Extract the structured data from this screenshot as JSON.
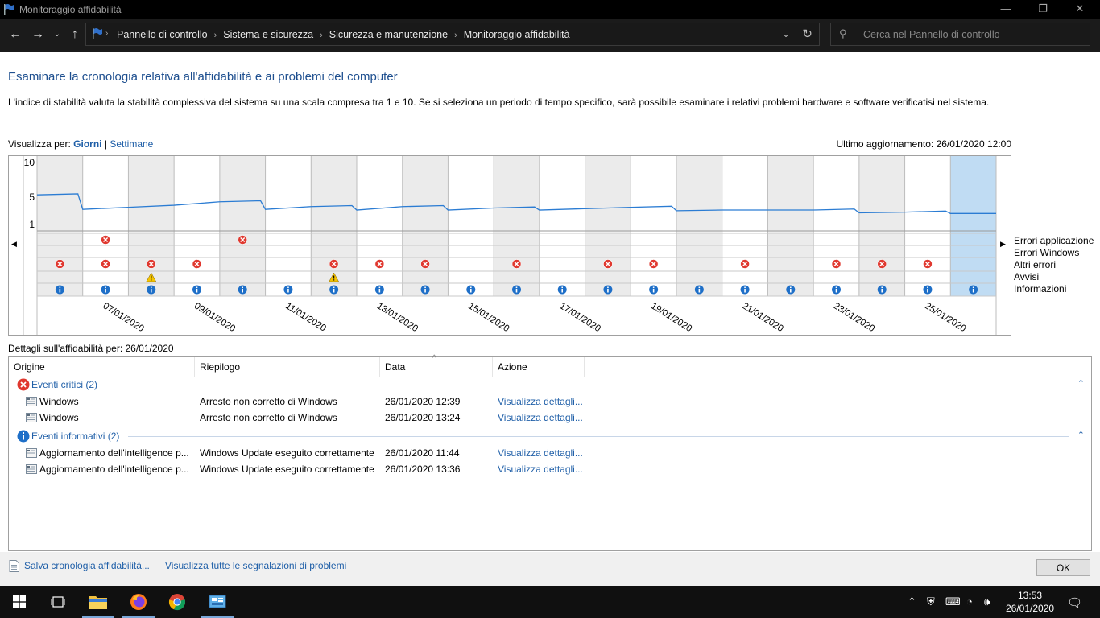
{
  "window": {
    "title": "Monitoraggio affidabilità",
    "minimize": "—",
    "maximize": "❐",
    "close": "✕"
  },
  "nav": {
    "breadcrumbs": [
      "Pannello di controllo",
      "Sistema e sicurezza",
      "Sicurezza e manutenzione",
      "Monitoraggio affidabilità"
    ],
    "search_placeholder": "Cerca nel Pannello di controllo"
  },
  "page": {
    "heading": "Esaminare la cronologia relativa all'affidabilità e ai problemi del computer",
    "description": "L'indice di stabilità valuta la stabilità complessiva del sistema su una scala compresa tra 1 e 10. Se si seleziona un periodo di tempo specifico, sarà possibile esaminare i relativi problemi hardware e software verificatisi nel sistema.",
    "view_by_label": "Visualizza per:",
    "view_days": "Giorni",
    "view_separator": "|",
    "view_weeks": "Settimane",
    "last_update": "Ultimo aggiornamento: 26/01/2020 12:00",
    "details_label": "Dettagli sull'affidabilità per: 26/01/2020"
  },
  "chart_data": {
    "type": "line",
    "y_ticks": [
      "10",
      "5",
      "1"
    ],
    "ylim": [
      1,
      10
    ],
    "x": [
      "06/01/2020",
      "07/01/2020",
      "08/01/2020",
      "09/01/2020",
      "10/01/2020",
      "11/01/2020",
      "12/01/2020",
      "13/01/2020",
      "14/01/2020",
      "15/01/2020",
      "16/01/2020",
      "17/01/2020",
      "18/01/2020",
      "19/01/2020",
      "20/01/2020",
      "21/01/2020",
      "22/01/2020",
      "23/01/2020",
      "24/01/2020",
      "25/01/2020",
      "26/01/2020"
    ],
    "x_labels_shown": [
      "07/01/2020",
      "09/01/2020",
      "11/01/2020",
      "13/01/2020",
      "15/01/2020",
      "17/01/2020",
      "19/01/2020",
      "21/01/2020",
      "23/01/2020",
      "25/01/2020"
    ],
    "selected": "26/01/2020",
    "stability": [
      5.3,
      3.2,
      3.5,
      3.8,
      4.3,
      3.2,
      3.6,
      3.1,
      3.6,
      3.1,
      3.4,
      3.1,
      3.3,
      3.5,
      3.0,
      3.1,
      3.1,
      3.1,
      2.7,
      2.8,
      2.6
    ],
    "row_labels": [
      "Errori applicazione",
      "Errori Windows",
      "Altri errori",
      "Avvisi",
      "Informazioni"
    ],
    "events": {
      "Errori applicazione": [
        0,
        1,
        0,
        0,
        1,
        0,
        0,
        0,
        0,
        0,
        0,
        0,
        0,
        0,
        0,
        0,
        0,
        0,
        0,
        0,
        0
      ],
      "Errori Windows": [
        0,
        0,
        0,
        0,
        0,
        0,
        0,
        0,
        0,
        0,
        0,
        0,
        0,
        0,
        0,
        0,
        0,
        0,
        0,
        0,
        0
      ],
      "Altri errori": [
        1,
        1,
        1,
        1,
        0,
        0,
        1,
        1,
        1,
        0,
        1,
        0,
        1,
        1,
        0,
        1,
        0,
        1,
        1,
        1,
        0
      ],
      "Avvisi": [
        0,
        0,
        1,
        0,
        0,
        0,
        1,
        0,
        0,
        0,
        0,
        0,
        0,
        0,
        0,
        0,
        0,
        0,
        0,
        0,
        0
      ],
      "Informazioni": [
        1,
        1,
        1,
        1,
        1,
        1,
        1,
        1,
        1,
        1,
        1,
        1,
        1,
        1,
        1,
        1,
        1,
        1,
        1,
        1,
        1
      ]
    },
    "colors": {
      "line": "#2b7cd3",
      "selected": "#c0dcf3",
      "error": "#e0382f",
      "warning": "#f5c400",
      "info": "#1e6fc8"
    }
  },
  "table": {
    "columns": [
      "Origine",
      "Riepilogo",
      "Data",
      "Azione"
    ],
    "groups": [
      {
        "label": "Eventi critici (2)",
        "icon": "error-icon",
        "rows": [
          {
            "origin": "Windows",
            "summary": "Arresto non corretto di Windows",
            "date": "26/01/2020 12:39",
            "action": "Visualizza dettagli..."
          },
          {
            "origin": "Windows",
            "summary": "Arresto non corretto di Windows",
            "date": "26/01/2020 13:24",
            "action": "Visualizza dettagli..."
          }
        ]
      },
      {
        "label": "Eventi informativi (2)",
        "icon": "info-icon",
        "rows": [
          {
            "origin": "Aggiornamento dell'intelligence p...",
            "summary": "Windows Update eseguito correttamente",
            "date": "26/01/2020 11:44",
            "action": "Visualizza dettagli..."
          },
          {
            "origin": "Aggiornamento dell'intelligence p...",
            "summary": "Windows Update eseguito correttamente",
            "date": "26/01/2020 13:36",
            "action": "Visualizza dettagli..."
          }
        ]
      }
    ]
  },
  "footer": {
    "save_link": "Salva cronologia affidabilità...",
    "view_all_link": "Visualizza tutte le segnalazioni di problemi",
    "ok": "OK"
  },
  "taskbar": {
    "time": "13:53",
    "date": "26/01/2020"
  }
}
